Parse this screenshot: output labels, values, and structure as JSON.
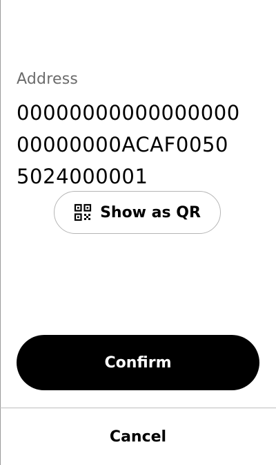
{
  "address": {
    "label": "Address",
    "lines": [
      "00000000000000000",
      "00000000ACAF0050",
      "5024000001"
    ]
  },
  "qr_button": {
    "label": "Show as QR",
    "icon": "qr-code-icon"
  },
  "confirm_button": {
    "label": "Confirm"
  },
  "cancel_button": {
    "label": "Cancel"
  },
  "colors": {
    "primary_button_bg": "#000000",
    "primary_button_text": "#ffffff",
    "secondary_text": "#6b6b6b",
    "outline": "#b5b5b5"
  }
}
